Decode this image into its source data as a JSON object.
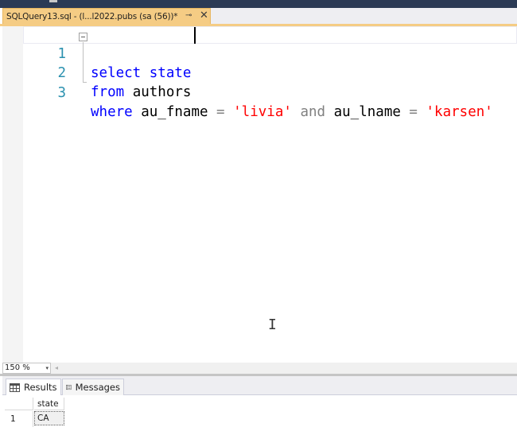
{
  "tab": {
    "title": "SQLQuery13.sql - (l...l2022.pubs (sa (56))*",
    "pin_glyph": "⊸",
    "close_glyph": "✕"
  },
  "editor": {
    "lines": [
      {
        "number": "1",
        "tokens": [
          {
            "text": "select",
            "kind": "keyword"
          },
          {
            "text": " state",
            "kind": "keyword"
          }
        ]
      },
      {
        "number": "2",
        "tokens": [
          {
            "text": "from",
            "kind": "keyword"
          },
          {
            "text": " authors",
            "kind": "identifier"
          }
        ]
      },
      {
        "number": "3",
        "tokens": [
          {
            "text": "where",
            "kind": "keyword"
          },
          {
            "text": " au_fname ",
            "kind": "identifier"
          },
          {
            "text": "=",
            "kind": "operator"
          },
          {
            "text": " ",
            "kind": "identifier"
          },
          {
            "text": "'livia'",
            "kind": "string"
          },
          {
            "text": " ",
            "kind": "identifier"
          },
          {
            "text": "and",
            "kind": "operator"
          },
          {
            "text": " au_lname ",
            "kind": "identifier"
          },
          {
            "text": "=",
            "kind": "operator"
          },
          {
            "text": " ",
            "kind": "identifier"
          },
          {
            "text": "'karsen'",
            "kind": "string"
          }
        ]
      }
    ],
    "mouse_cursor_glyph": "I"
  },
  "zoom": {
    "value": "150 %",
    "arrow_glyph": "▾",
    "scroll_left_glyph": "◂"
  },
  "results": {
    "tabs": {
      "results_label": "Results",
      "messages_label": "Messages"
    },
    "columns": [
      "state"
    ],
    "rows": [
      {
        "row_number": "1",
        "values": [
          "CA"
        ]
      }
    ]
  },
  "colors": {
    "keyword": "#0000ff",
    "string": "#ff0000",
    "operator": "#808080",
    "identifier": "#000000",
    "line_number": "#2b91af",
    "tab_active": "#f5cc84"
  },
  "icons": {
    "results_tab": "grid-icon",
    "messages_tab": "messages-icon",
    "collapse": "collapse-minus-icon",
    "pin": "pin-icon",
    "close": "close-icon"
  }
}
